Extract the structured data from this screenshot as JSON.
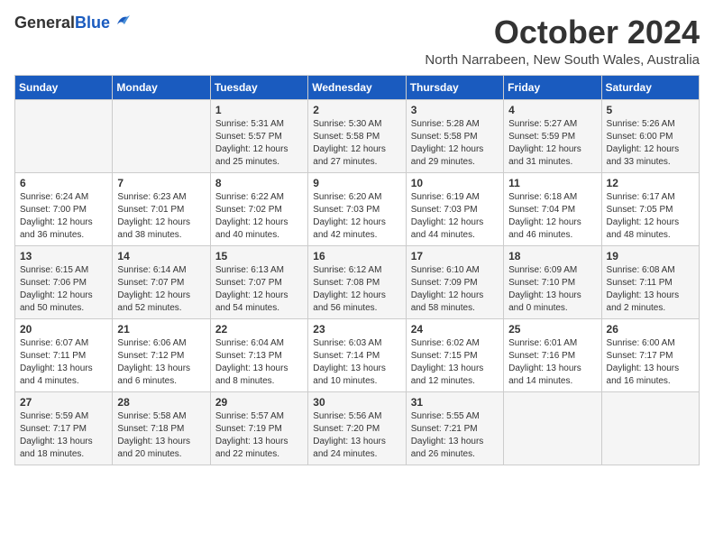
{
  "header": {
    "logo_general": "General",
    "logo_blue": "Blue",
    "month": "October 2024",
    "location": "North Narrabeen, New South Wales, Australia"
  },
  "days_of_week": [
    "Sunday",
    "Monday",
    "Tuesday",
    "Wednesday",
    "Thursday",
    "Friday",
    "Saturday"
  ],
  "weeks": [
    [
      {
        "day": "",
        "info": ""
      },
      {
        "day": "",
        "info": ""
      },
      {
        "day": "1",
        "info": "Sunrise: 5:31 AM\nSunset: 5:57 PM\nDaylight: 12 hours\nand 25 minutes."
      },
      {
        "day": "2",
        "info": "Sunrise: 5:30 AM\nSunset: 5:58 PM\nDaylight: 12 hours\nand 27 minutes."
      },
      {
        "day": "3",
        "info": "Sunrise: 5:28 AM\nSunset: 5:58 PM\nDaylight: 12 hours\nand 29 minutes."
      },
      {
        "day": "4",
        "info": "Sunrise: 5:27 AM\nSunset: 5:59 PM\nDaylight: 12 hours\nand 31 minutes."
      },
      {
        "day": "5",
        "info": "Sunrise: 5:26 AM\nSunset: 6:00 PM\nDaylight: 12 hours\nand 33 minutes."
      }
    ],
    [
      {
        "day": "6",
        "info": "Sunrise: 6:24 AM\nSunset: 7:00 PM\nDaylight: 12 hours\nand 36 minutes."
      },
      {
        "day": "7",
        "info": "Sunrise: 6:23 AM\nSunset: 7:01 PM\nDaylight: 12 hours\nand 38 minutes."
      },
      {
        "day": "8",
        "info": "Sunrise: 6:22 AM\nSunset: 7:02 PM\nDaylight: 12 hours\nand 40 minutes."
      },
      {
        "day": "9",
        "info": "Sunrise: 6:20 AM\nSunset: 7:03 PM\nDaylight: 12 hours\nand 42 minutes."
      },
      {
        "day": "10",
        "info": "Sunrise: 6:19 AM\nSunset: 7:03 PM\nDaylight: 12 hours\nand 44 minutes."
      },
      {
        "day": "11",
        "info": "Sunrise: 6:18 AM\nSunset: 7:04 PM\nDaylight: 12 hours\nand 46 minutes."
      },
      {
        "day": "12",
        "info": "Sunrise: 6:17 AM\nSunset: 7:05 PM\nDaylight: 12 hours\nand 48 minutes."
      }
    ],
    [
      {
        "day": "13",
        "info": "Sunrise: 6:15 AM\nSunset: 7:06 PM\nDaylight: 12 hours\nand 50 minutes."
      },
      {
        "day": "14",
        "info": "Sunrise: 6:14 AM\nSunset: 7:07 PM\nDaylight: 12 hours\nand 52 minutes."
      },
      {
        "day": "15",
        "info": "Sunrise: 6:13 AM\nSunset: 7:07 PM\nDaylight: 12 hours\nand 54 minutes."
      },
      {
        "day": "16",
        "info": "Sunrise: 6:12 AM\nSunset: 7:08 PM\nDaylight: 12 hours\nand 56 minutes."
      },
      {
        "day": "17",
        "info": "Sunrise: 6:10 AM\nSunset: 7:09 PM\nDaylight: 12 hours\nand 58 minutes."
      },
      {
        "day": "18",
        "info": "Sunrise: 6:09 AM\nSunset: 7:10 PM\nDaylight: 13 hours\nand 0 minutes."
      },
      {
        "day": "19",
        "info": "Sunrise: 6:08 AM\nSunset: 7:11 PM\nDaylight: 13 hours\nand 2 minutes."
      }
    ],
    [
      {
        "day": "20",
        "info": "Sunrise: 6:07 AM\nSunset: 7:11 PM\nDaylight: 13 hours\nand 4 minutes."
      },
      {
        "day": "21",
        "info": "Sunrise: 6:06 AM\nSunset: 7:12 PM\nDaylight: 13 hours\nand 6 minutes."
      },
      {
        "day": "22",
        "info": "Sunrise: 6:04 AM\nSunset: 7:13 PM\nDaylight: 13 hours\nand 8 minutes."
      },
      {
        "day": "23",
        "info": "Sunrise: 6:03 AM\nSunset: 7:14 PM\nDaylight: 13 hours\nand 10 minutes."
      },
      {
        "day": "24",
        "info": "Sunrise: 6:02 AM\nSunset: 7:15 PM\nDaylight: 13 hours\nand 12 minutes."
      },
      {
        "day": "25",
        "info": "Sunrise: 6:01 AM\nSunset: 7:16 PM\nDaylight: 13 hours\nand 14 minutes."
      },
      {
        "day": "26",
        "info": "Sunrise: 6:00 AM\nSunset: 7:17 PM\nDaylight: 13 hours\nand 16 minutes."
      }
    ],
    [
      {
        "day": "27",
        "info": "Sunrise: 5:59 AM\nSunset: 7:17 PM\nDaylight: 13 hours\nand 18 minutes."
      },
      {
        "day": "28",
        "info": "Sunrise: 5:58 AM\nSunset: 7:18 PM\nDaylight: 13 hours\nand 20 minutes."
      },
      {
        "day": "29",
        "info": "Sunrise: 5:57 AM\nSunset: 7:19 PM\nDaylight: 13 hours\nand 22 minutes."
      },
      {
        "day": "30",
        "info": "Sunrise: 5:56 AM\nSunset: 7:20 PM\nDaylight: 13 hours\nand 24 minutes."
      },
      {
        "day": "31",
        "info": "Sunrise: 5:55 AM\nSunset: 7:21 PM\nDaylight: 13 hours\nand 26 minutes."
      },
      {
        "day": "",
        "info": ""
      },
      {
        "day": "",
        "info": ""
      }
    ]
  ]
}
